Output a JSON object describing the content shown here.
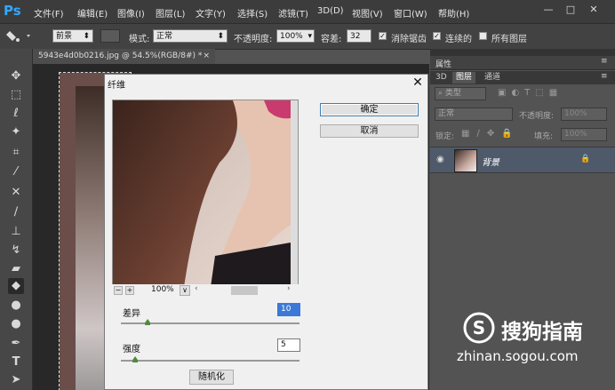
{
  "app": {
    "logo": "Ps"
  },
  "menu": [
    "文件(F)",
    "编辑(E)",
    "图像(I)",
    "图层(L)",
    "文字(Y)",
    "选择(S)",
    "滤镜(T)",
    "3D(D)",
    "视图(V)",
    "窗口(W)",
    "帮助(H)"
  ],
  "window_controls": {
    "minimize": "—",
    "maximize": "□",
    "close": "✕"
  },
  "options": {
    "fill_source": "前景",
    "mode_label": "模式:",
    "mode_value": "正常",
    "opacity_label": "不透明度:",
    "opacity_value": "100%",
    "tolerance_label": "容差:",
    "tolerance_value": "32",
    "antialias_label": "消除锯齿",
    "antialias_checked": true,
    "contiguous_label": "连续的",
    "contiguous_checked": true,
    "all_layers_label": "所有图层",
    "all_layers_checked": false
  },
  "document_tab": {
    "title": "5943e4d0b0216.jpg @ 54.5%(RGB/8#) *",
    "close": "×"
  },
  "tools": [
    "move-icon",
    "marquee-icon",
    "lasso-icon",
    "magic-wand-icon",
    "crop-icon",
    "eyedropper-icon",
    "healing-icon",
    "brush-icon",
    "stamp-icon",
    "history-brush-icon",
    "eraser-icon",
    "paint-bucket-icon",
    "blur-icon",
    "dodge-icon",
    "pen-icon",
    "type-icon",
    "path-select-icon"
  ],
  "dialog": {
    "title": "纤维",
    "close": "✕",
    "ok_label": "确定",
    "cancel_label": "取消",
    "zoom_value": "100%",
    "variance_label": "差异",
    "variance_value": "10",
    "variance_level": 0.15,
    "strength_label": "强度",
    "strength_value": "5",
    "strength_level": 0.08,
    "randomize_label": "随机化"
  },
  "panels": {
    "properties_tab": "属性",
    "layer_tabs": [
      "3D",
      "图层",
      "通道"
    ],
    "active_layer_tab": "图层",
    "filter_type": "类型",
    "blend_mode": "正常",
    "opacity_label": "不透明度:",
    "opacity_value": "100%",
    "lock_label": "锁定:",
    "fill_label": "填充:",
    "fill_value": "100%",
    "layer_name": "背景"
  },
  "watermark": {
    "text": "搜狗指南",
    "url": "zhinan.sogou.com"
  },
  "colors": {
    "accent": "#31a8ff",
    "panel_dark": "#3c3c3c",
    "selected_layer": "#4e5a6a"
  }
}
